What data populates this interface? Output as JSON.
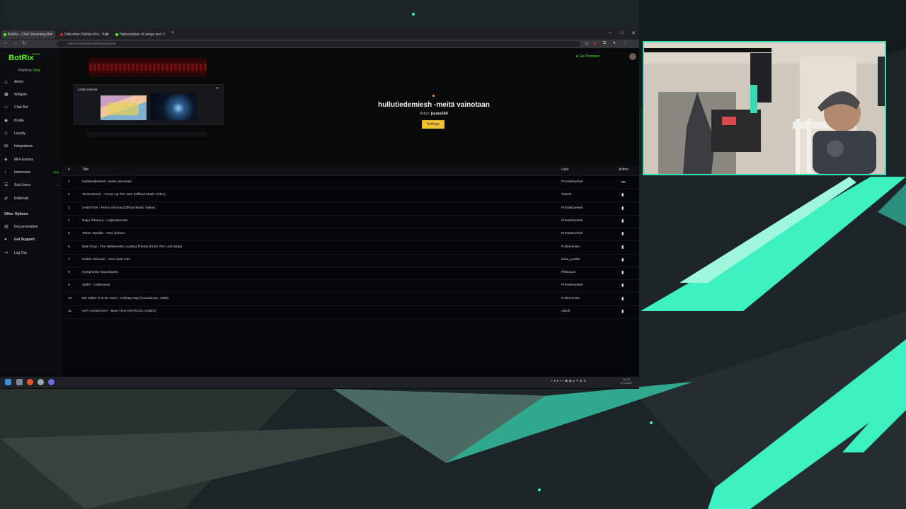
{
  "browser": {
    "tabs": [
      {
        "label": "BotRix - Chat Streaming Bo",
        "active": true,
        "color": "#53fc18"
      },
      {
        "label": "Odkushan Sollatu Kivi - Kick",
        "active": false,
        "color": "#e02020"
      },
      {
        "label": "Hallusolaban of songs and",
        "active": false,
        "color": "#53fc18"
      }
    ],
    "url": "botrix.live/dashboard/songrequest",
    "window_controls": [
      "–",
      "□",
      "✕"
    ]
  },
  "sidebar": {
    "brand": "BotRix",
    "beta": "BETA",
    "platform_label": "Platform:",
    "platform_value": "Kick",
    "items": [
      {
        "label": "Alerts",
        "icon": "bell-icon",
        "glyph": "△"
      },
      {
        "label": "Widgets",
        "icon": "grid-icon",
        "glyph": "▦"
      },
      {
        "label": "Chat Bot",
        "icon": "chat-icon",
        "glyph": "▭"
      },
      {
        "label": "Profile",
        "icon": "user-icon",
        "glyph": "◉"
      },
      {
        "label": "Loyalty",
        "icon": "gift-icon",
        "glyph": "◇"
      },
      {
        "label": "Integrations",
        "icon": "plug-icon",
        "glyph": "⊞"
      },
      {
        "label": "Mini-Games",
        "icon": "gamepad-icon",
        "glyph": "◈"
      },
      {
        "label": "Immersion",
        "icon": "music-icon",
        "glyph": "♪",
        "badge": "NEW"
      },
      {
        "label": "Sub Users",
        "icon": "users-icon",
        "glyph": "☰",
        "chevron": true
      },
      {
        "label": "Referrals",
        "icon": "share-icon",
        "glyph": "⇄"
      }
    ],
    "other_section": "Other Options",
    "other_items": [
      {
        "label": "Documentation",
        "icon": "doc-icon",
        "glyph": "▤"
      },
      {
        "label": "Get Support",
        "icon": "support-icon",
        "glyph": "●"
      },
      {
        "label": "Log Out",
        "icon": "logout-icon",
        "glyph": "⇥"
      }
    ]
  },
  "topbar": {
    "premium": "Go Premium"
  },
  "popup": {
    "title": "Lisää videoita"
  },
  "now_playing": {
    "title": "hullutiedemiesh -meitä vainotaan",
    "artist_label": "Artist:",
    "artist_value": "juuso334",
    "skip_label": "Settings"
  },
  "table": {
    "headers": {
      "num": "#",
      "title": "Title",
      "user": "User",
      "action": "Action"
    },
    "rows": [
      {
        "num": "1",
        "title": "hullutiedemiesh -meitä vainotaan",
        "user": "PrinssiEverkel",
        "action": "play-next-icon"
      },
      {
        "num": "2",
        "title": "Technotronic - Pump Up The Jam (Official Music Video)",
        "user": "Tuhelo",
        "action": "trash-icon"
      },
      {
        "num": "3",
        "title": "SABATON - Primo Victoria (Official Music Video)",
        "user": "PrinssiEverkel",
        "action": "trash-icon"
      },
      {
        "num": "4",
        "title": "Reijo Rihanna - Laijimaksnallo",
        "user": "PrinssiEverkel",
        "action": "trash-icon"
      },
      {
        "num": "5",
        "title": "Tokoo Trpullet - Vteri puheet",
        "user": "PrinssiEverkel",
        "action": "trash-icon"
      },
      {
        "num": "6",
        "title": "Matt Gray - The Wilderness Loading Theme (From The Last Ninja)",
        "user": "Pullverimies",
        "action": "trash-icon"
      },
      {
        "num": "7",
        "title": "Heikki Helminki - Vieri Vedi Vieri",
        "user": "kube_joolller",
        "action": "trash-icon"
      },
      {
        "num": "8",
        "title": "Symphonia Apocalypsis",
        "user": "PikkuLuci",
        "action": "trash-icon"
      },
      {
        "num": "9",
        "title": "SpiltT - Carbonara",
        "user": "PrinssiEverkel",
        "action": "trash-icon"
      },
      {
        "num": "10",
        "title": "MC Miker G & DJ Sven - Holiday Rap (Countdown, 1986)",
        "user": "Pullverimies",
        "action": "trash-icon"
      },
      {
        "num": "11",
        "title": "ANY GIVEN DAY - Best Time (OFFICIAL VIDEO)",
        "user": "olisoli",
        "action": "trash-icon"
      }
    ]
  },
  "taskbar": {
    "clock": "16.23",
    "date": "9.3.2024"
  },
  "colors": {
    "accent": "#53fc18",
    "skip_button": "#f1c232",
    "cam_border": "#35e0b5",
    "overlay_teal": "#3cf0c0"
  }
}
